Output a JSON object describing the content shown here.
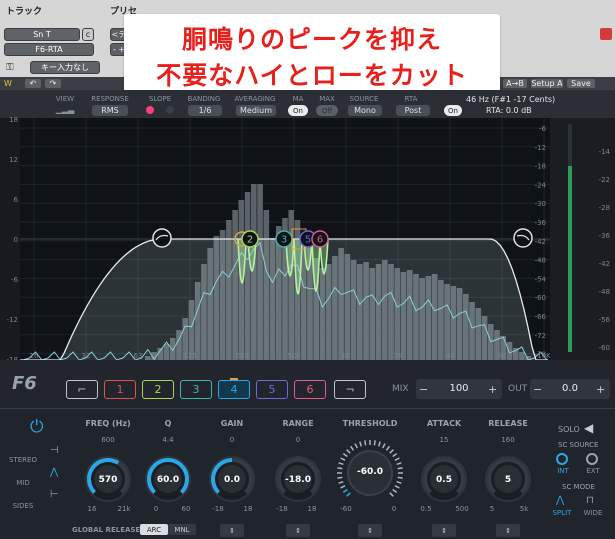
{
  "header": {
    "track_label": "トラック",
    "preset_label": "プリセ",
    "track_name": "Sn T",
    "track_group": "c",
    "plugin_name": "F6-RTA",
    "key_label": "キー入力なし",
    "preset_btn1": "<デ",
    "preset_btn2": "- +",
    "ab_label": "A→B",
    "setup_label": "Setup A",
    "save_label": "Save"
  },
  "banner": {
    "line1": "胴鳴りのピークを抑え",
    "line2": "不要なハイとローをカット"
  },
  "toolbar": {
    "view_label": "VIEW",
    "response_label": "RESPONSE",
    "response_value": "RMS",
    "slope_label": "SLOPE",
    "banding_label": "BANDING",
    "banding_value": "1/6",
    "averaging_label": "AVERAGING",
    "averaging_value": "Medium",
    "ma_label": "MA",
    "ma_value": "On",
    "max_label": "MAX",
    "max_value": "Off",
    "source_label": "SOURCE",
    "source_value": "Mono",
    "rta_label": "RTA",
    "rta_value": "Post",
    "rta_toggle": "On",
    "freq_readout": "46 Hz (F#1 -17 Cents)",
    "rta_readout": "RTA: 0.0 dB"
  },
  "graph": {
    "db_left": [
      "18",
      "12",
      "6",
      "0",
      "-6",
      "-12",
      "-18"
    ],
    "db_mid": [
      "-6",
      "-12",
      "-18",
      "-24",
      "-30",
      "-36",
      "-42",
      "-48",
      "-54",
      "-60",
      "-66",
      "-72",
      "-78"
    ],
    "db_right": [
      "-14",
      "-22",
      "-28",
      "-36",
      "-42",
      "-48",
      "-56",
      "-60"
    ],
    "freq_ticks": [
      "16",
      "32",
      "63",
      "125",
      "250",
      "500",
      "1K",
      "2K",
      "4K",
      "8K",
      "16K"
    ],
    "band_markers": [
      "2",
      "3",
      "5",
      "6"
    ]
  },
  "bands": {
    "logo": "F6",
    "buttons": [
      "1",
      "2",
      "3",
      "4",
      "5",
      "6"
    ],
    "mix_label": "MIX",
    "mix_value": "100",
    "out_label": "OUT",
    "out_value": "0.0",
    "minus": "−",
    "plus": "+"
  },
  "lower": {
    "freq_label": "FREQ (Hz)",
    "freq_top": "600",
    "freq_value": "570",
    "freq_min": "16",
    "freq_max": "21k",
    "q_label": "Q",
    "q_top": "4.4",
    "q_value": "60.0",
    "q_min": "0",
    "q_max": "60",
    "gain_label": "GAIN",
    "gain_top": "0",
    "gain_value": "0.0",
    "gain_min": "-18",
    "gain_max": "18",
    "range_label": "RANGE",
    "range_top": "0",
    "range_value": "-18.0",
    "range_min": "-18",
    "range_max": "18",
    "threshold_label": "THRESHOLD",
    "threshold_value": "-60.0",
    "threshold_min": "-60",
    "threshold_max": "0",
    "attack_label": "ATTACK",
    "attack_top": "15",
    "attack_value": "0.5",
    "attack_min": "0.5",
    "attack_max": "500",
    "release_label": "RELEASE",
    "release_top": "160",
    "release_value": "5",
    "release_min": "5",
    "release_max": "5k",
    "stereo_label": "STEREO",
    "mid_label": "MID",
    "sides_label": "SIDES",
    "solo_label": "SOLO",
    "sc_source_label": "SC SOURCE",
    "int_label": "INT",
    "ext_label": "EXT",
    "sc_mode_label": "SC MODE",
    "split_label": "SPLIT",
    "wide_label": "WIDE",
    "global_release_label": "GLOBAL RELEASE",
    "arc_label": "ARC",
    "mnl_label": "MNL",
    "stepper": "⇕"
  },
  "colors": {
    "accent": "#2aa7e8",
    "band1": "#e05252",
    "band2": "#a6d65a",
    "band3": "#3bb7b3",
    "band4": "#2aa7e8",
    "band5": "#6b68e0",
    "band6": "#e05a8c"
  }
}
